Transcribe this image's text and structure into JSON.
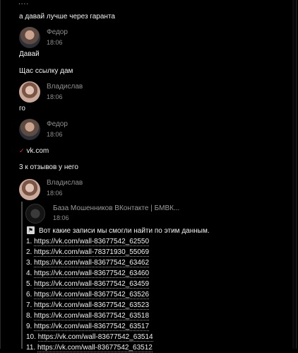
{
  "chat": {
    "prev_dots": "....",
    "msgs": {
      "m1": "а давай лучше через гаранта",
      "m2": "Давай",
      "m3": "Щас ссылку дам",
      "m4": "го",
      "m5": "vk.com",
      "m6": "3 к отзывов у него"
    },
    "senders": {
      "s1": {
        "name": "Федор",
        "time": "18:06"
      },
      "s2": {
        "name": "Владислав",
        "time": "18:06"
      },
      "s3": {
        "name": "Федор",
        "time": "18:06"
      },
      "s4": {
        "name": "Владислав",
        "time": "18:06"
      }
    },
    "forwarded": {
      "name": "База Мошенников ВКонтакте | БМВК...",
      "time": "18:06",
      "intro": "Вот какие записи мы смогли найти по этим данным.",
      "items": [
        {
          "n": "1.",
          "url": "https://vk.com/wall-83677542_62550"
        },
        {
          "n": "2.",
          "url": "https://vk.com/wall-78371930_55069"
        },
        {
          "n": "3.",
          "url": "https://vk.com/wall-83677542_63462"
        },
        {
          "n": "4.",
          "url": "https://vk.com/wall-83677542_63460"
        },
        {
          "n": "5.",
          "url": "https://vk.com/wall-83677542_63459"
        },
        {
          "n": "6.",
          "url": "https://vk.com/wall-83677542_63526"
        },
        {
          "n": "7.",
          "url": "https://vk.com/wall-83677542_63523"
        },
        {
          "n": "8.",
          "url": "https://vk.com/wall-83677542_63518"
        },
        {
          "n": "9.",
          "url": "https://vk.com/wall-83677542_63517"
        },
        {
          "n": "10.",
          "url": "https://vk.com/wall-83677542_63514"
        },
        {
          "n": "11.",
          "url": "https://vk.com/wall-83677542_63512"
        }
      ]
    }
  },
  "colors": {
    "background": "#000000",
    "meta_text": "#8f8f8f",
    "vk_mark": "#d23b3b"
  }
}
